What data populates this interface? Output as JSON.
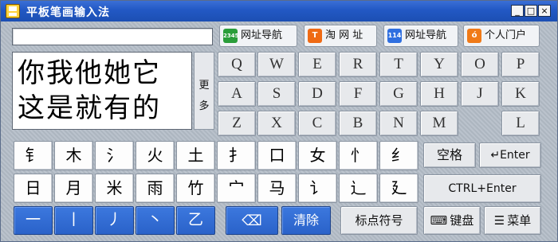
{
  "window": {
    "title": "平板笔画输入法",
    "minimize": "_",
    "restore": "□",
    "close": "×"
  },
  "links": [
    {
      "icon": "2345",
      "icon_color": "#2a9d3a",
      "label": "网址导航"
    },
    {
      "icon": "T",
      "icon_color": "#ef6a14",
      "label": "淘 网 址"
    },
    {
      "icon": "114",
      "icon_color": "#2f6fe0",
      "label": "网址导航"
    },
    {
      "icon": "ó",
      "icon_color": "#f07a18",
      "label": "个人门户"
    }
  ],
  "candidates": {
    "row1": "你我他她它",
    "row2": "这是就有的",
    "more1": "更",
    "more2": "多"
  },
  "letters": {
    "row1": [
      "Q",
      "W",
      "E",
      "R",
      "T",
      "Y",
      "O",
      "P"
    ],
    "row2": [
      "A",
      "S",
      "D",
      "F",
      "G",
      "H",
      "J",
      "K"
    ],
    "row3": [
      "Z",
      "X",
      "C",
      "B",
      "N",
      "M",
      "L"
    ]
  },
  "radicals": {
    "row1": [
      "钅",
      "木",
      "氵",
      "火",
      "土",
      "扌",
      "口",
      "女",
      "忄",
      "纟"
    ],
    "row2": [
      "日",
      "月",
      "米",
      "雨",
      "竹",
      "宀",
      "马",
      "讠",
      "辶",
      "廴"
    ]
  },
  "strokes": [
    "一",
    "丨",
    "丿",
    "丶",
    "乙"
  ],
  "actions": {
    "space": "空格",
    "enter": "↵Enter",
    "ctrl_enter": "CTRL+Enter",
    "backspace_icon": "⌫",
    "clear": "清除",
    "punctuation": "标点符号",
    "keyboard_icon": "⌨",
    "keyboard": "键盘",
    "menu_icon": "☰",
    "menu": "菜单"
  },
  "colors": {
    "titlebar": "#2258c4",
    "accent_blue": "#2a62c9",
    "key_gray": "#e7e9ec",
    "key_white": "#fdfdfd"
  }
}
